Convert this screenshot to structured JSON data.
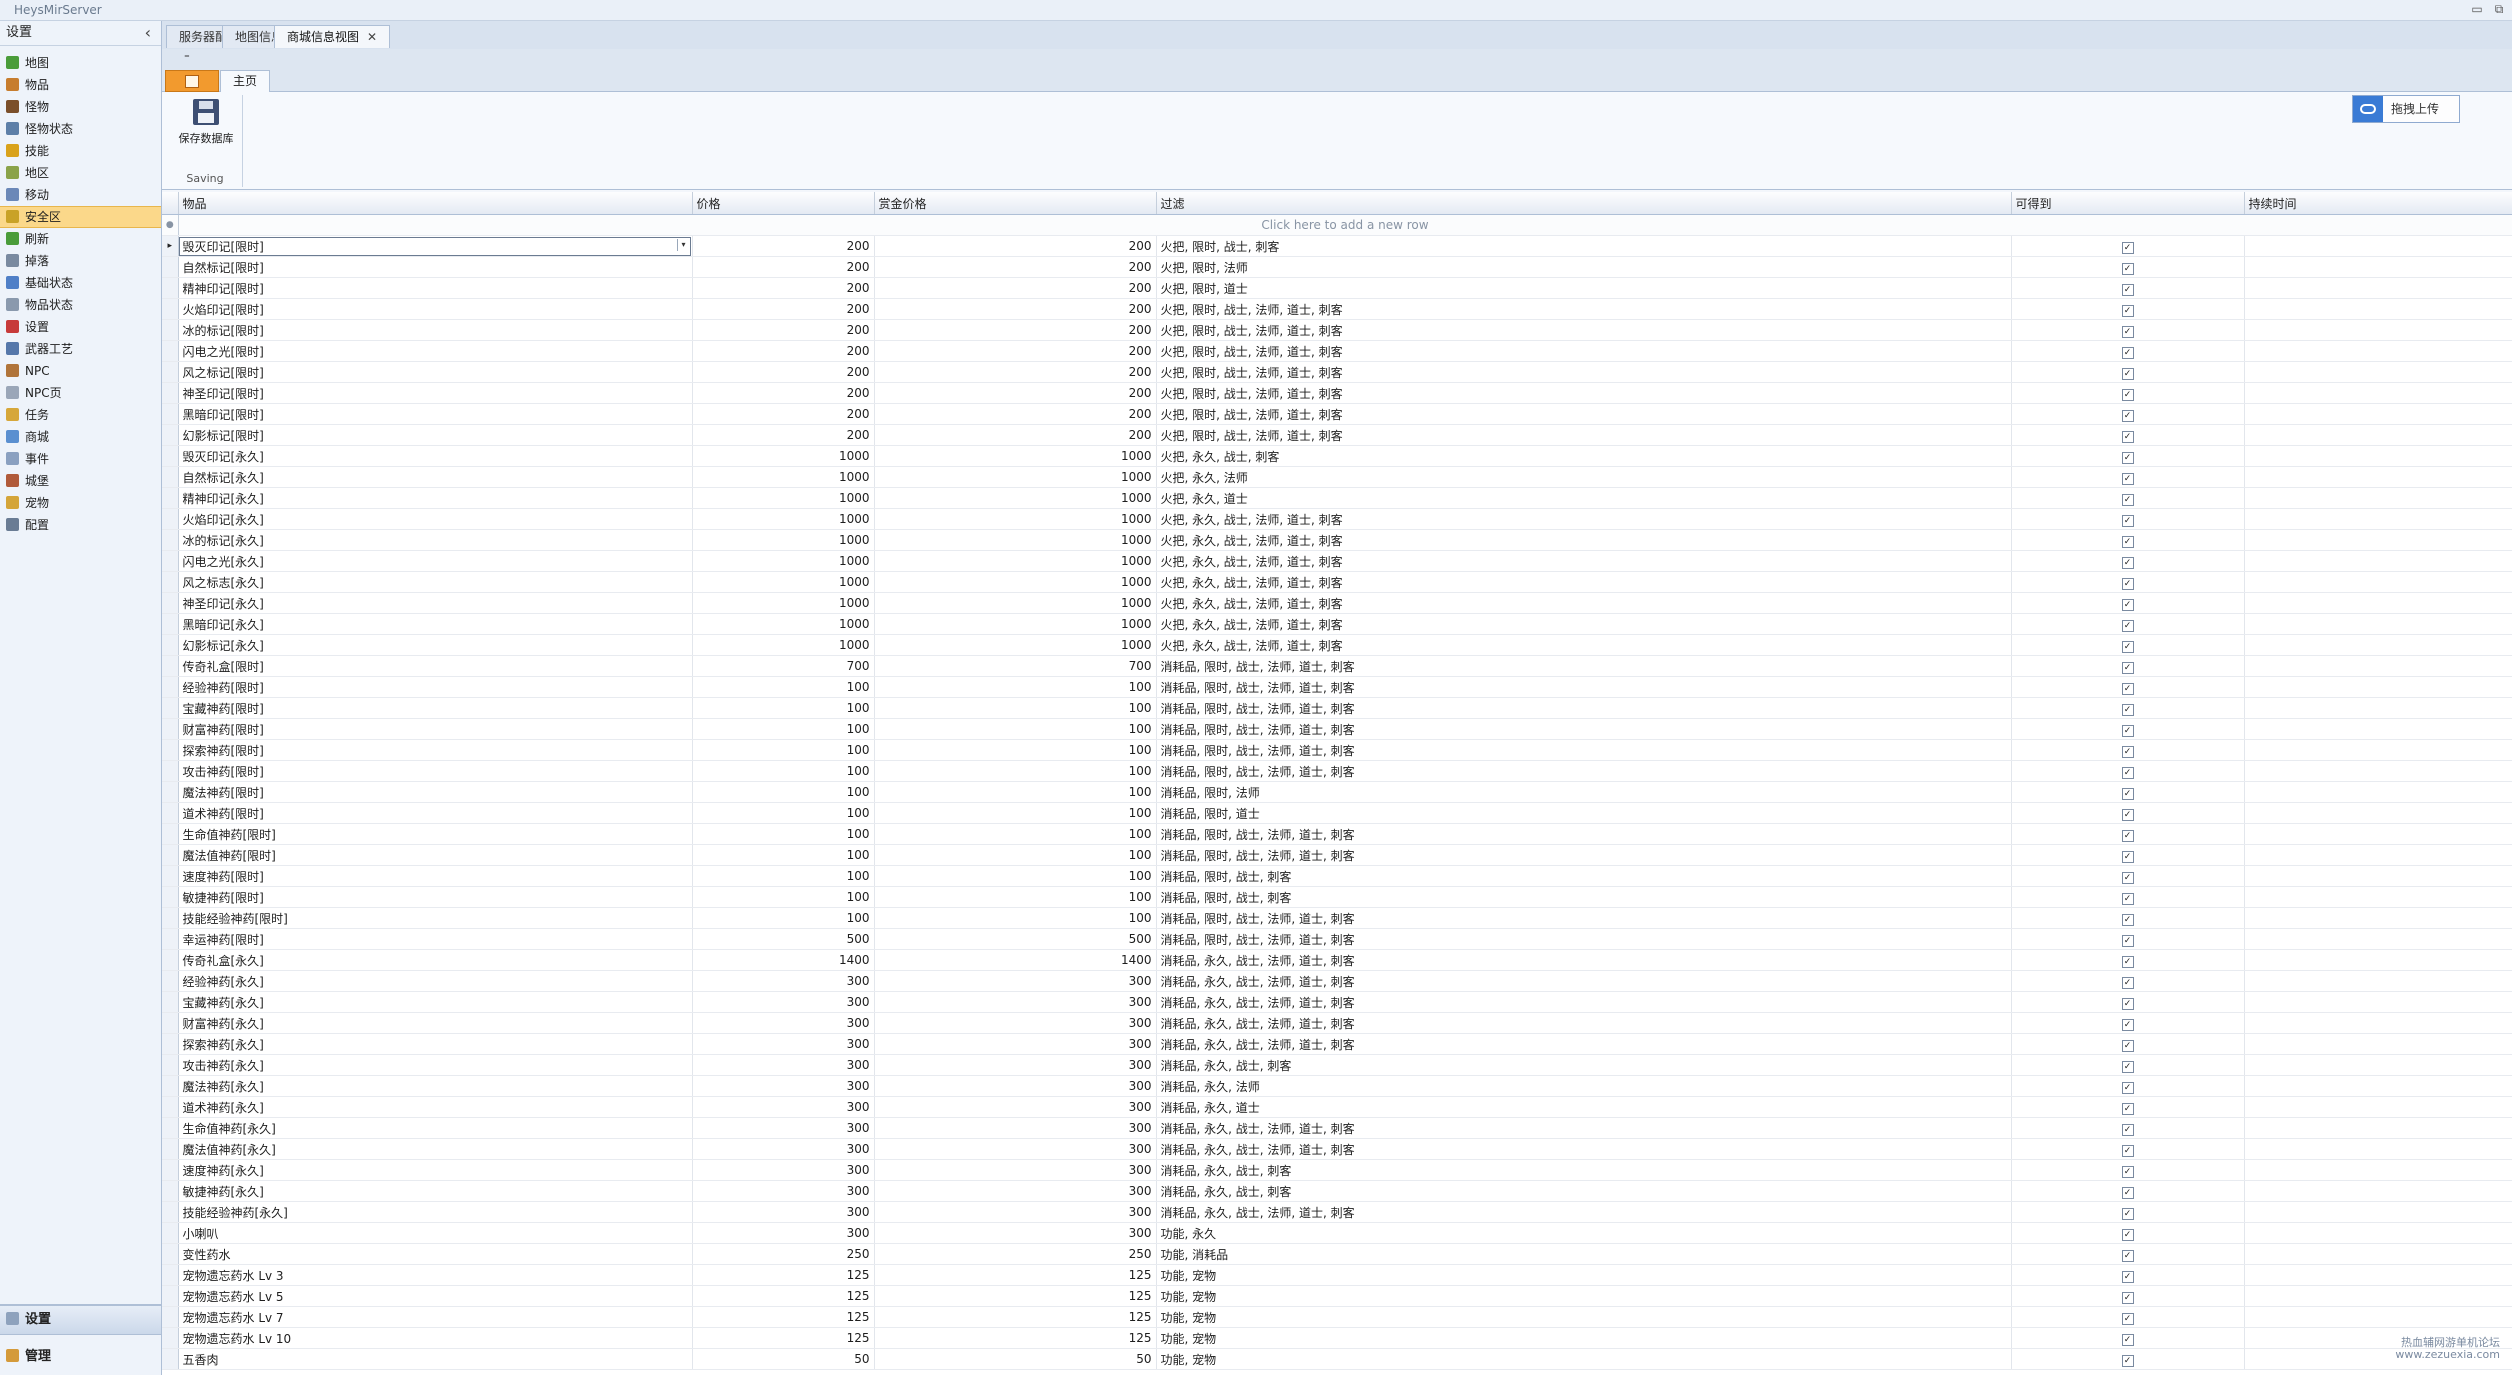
{
  "app": {
    "title": "HeysMirServer"
  },
  "sidebar": {
    "header": "设置",
    "items": [
      {
        "label": "地图",
        "icon": "map-icon",
        "color": "#4a9c3a"
      },
      {
        "label": "物品",
        "icon": "item-icon",
        "color": "#c77d2e"
      },
      {
        "label": "怪物",
        "icon": "monster-icon",
        "color": "#7b4f2a"
      },
      {
        "label": "怪物状态",
        "icon": "monster-status-icon",
        "color": "#5d7fa8"
      },
      {
        "label": "技能",
        "icon": "skill-icon",
        "color": "#d9a21b"
      },
      {
        "label": "地区",
        "icon": "region-icon",
        "color": "#8aa34a"
      },
      {
        "label": "移动",
        "icon": "move-icon",
        "color": "#6b88b8"
      },
      {
        "label": "安全区",
        "icon": "safezone-icon",
        "color": "#c9a227"
      },
      {
        "label": "刷新",
        "icon": "refresh-icon",
        "color": "#4a9c3a"
      },
      {
        "label": "掉落",
        "icon": "drop-icon",
        "color": "#7a8aa0"
      },
      {
        "label": "基础状态",
        "icon": "base-stats-icon",
        "color": "#4f7fc7"
      },
      {
        "label": "物品状态",
        "icon": "item-stats-icon",
        "color": "#8a99ad"
      },
      {
        "label": "设置",
        "icon": "settings-icon",
        "color": "#c73a3a"
      },
      {
        "label": "武器工艺",
        "icon": "weapon-craft-icon",
        "color": "#5577aa"
      },
      {
        "label": "NPC",
        "icon": "npc-icon",
        "color": "#b0743a"
      },
      {
        "label": "NPC页",
        "icon": "npc-page-icon",
        "color": "#9aa6b8"
      },
      {
        "label": "任务",
        "icon": "quest-icon",
        "color": "#d6a73a"
      },
      {
        "label": "商城",
        "icon": "shop-icon",
        "color": "#5a8fd0"
      },
      {
        "label": "事件",
        "icon": "event-icon",
        "color": "#8aa0c0"
      },
      {
        "label": "城堡",
        "icon": "castle-icon",
        "color": "#b05a3a"
      },
      {
        "label": "宠物",
        "icon": "pet-icon",
        "color": "#d4a53a"
      },
      {
        "label": "配置",
        "icon": "config-icon",
        "color": "#6a7c94"
      }
    ],
    "active_index": 7,
    "groups": [
      {
        "label": "设置",
        "icon": "settings-group-icon"
      },
      {
        "label": "管理",
        "icon": "manage-group-icon"
      }
    ]
  },
  "doctabs": [
    {
      "label": "服务器配置"
    },
    {
      "label": "地图信息"
    },
    {
      "label": "商城信息视图",
      "close": "✕"
    }
  ],
  "ribbon": {
    "qat": "⁼",
    "tab": "主页",
    "save_label": "保存数据库",
    "group_caption": "Saving",
    "upload_label": "拖拽上传"
  },
  "grid": {
    "columns": [
      "物品",
      "价格",
      "赏金价格",
      "过滤",
      "可得到",
      "持续时间"
    ],
    "new_row_hint": "Click here to add a new row",
    "rows": [
      [
        "毁灭印记[限时]",
        "200",
        "200",
        "火把, 限时, 战士, 刺客"
      ],
      [
        "自然标记[限时]",
        "200",
        "200",
        "火把, 限时, 法师"
      ],
      [
        "精神印记[限时]",
        "200",
        "200",
        "火把, 限时, 道士"
      ],
      [
        "火焰印记[限时]",
        "200",
        "200",
        "火把, 限时, 战士, 法师, 道士, 刺客"
      ],
      [
        "冰的标记[限时]",
        "200",
        "200",
        "火把, 限时, 战士, 法师, 道士, 刺客"
      ],
      [
        "闪电之光[限时]",
        "200",
        "200",
        "火把, 限时, 战士, 法师, 道士, 刺客"
      ],
      [
        "风之标记[限时]",
        "200",
        "200",
        "火把, 限时, 战士, 法师, 道士, 刺客"
      ],
      [
        "神圣印记[限时]",
        "200",
        "200",
        "火把, 限时, 战士, 法师, 道士, 刺客"
      ],
      [
        "黑暗印记[限时]",
        "200",
        "200",
        "火把, 限时, 战士, 法师, 道士, 刺客"
      ],
      [
        "幻影标记[限时]",
        "200",
        "200",
        "火把, 限时, 战士, 法师, 道士, 刺客"
      ],
      [
        "毁灭印记[永久]",
        "1000",
        "1000",
        "火把, 永久, 战士, 刺客"
      ],
      [
        "自然标记[永久]",
        "1000",
        "1000",
        "火把, 永久, 法师"
      ],
      [
        "精神印记[永久]",
        "1000",
        "1000",
        "火把, 永久, 道士"
      ],
      [
        "火焰印记[永久]",
        "1000",
        "1000",
        "火把, 永久, 战士, 法师, 道士, 刺客"
      ],
      [
        "冰的标记[永久]",
        "1000",
        "1000",
        "火把, 永久, 战士, 法师, 道士, 刺客"
      ],
      [
        "闪电之光[永久]",
        "1000",
        "1000",
        "火把, 永久, 战士, 法师, 道士, 刺客"
      ],
      [
        "风之标志[永久]",
        "1000",
        "1000",
        "火把, 永久, 战士, 法师, 道士, 刺客"
      ],
      [
        "神圣印记[永久]",
        "1000",
        "1000",
        "火把, 永久, 战士, 法师, 道士, 刺客"
      ],
      [
        "黑暗印记[永久]",
        "1000",
        "1000",
        "火把, 永久, 战士, 法师, 道士, 刺客"
      ],
      [
        "幻影标记[永久]",
        "1000",
        "1000",
        "火把, 永久, 战士, 法师, 道士, 刺客"
      ],
      [
        "传奇礼盒[限时]",
        "700",
        "700",
        "消耗品, 限时, 战士, 法师, 道士, 刺客"
      ],
      [
        "经验神药[限时]",
        "100",
        "100",
        "消耗品, 限时, 战士, 法师, 道士, 刺客"
      ],
      [
        "宝藏神药[限时]",
        "100",
        "100",
        "消耗品, 限时, 战士, 法师, 道士, 刺客"
      ],
      [
        "财富神药[限时]",
        "100",
        "100",
        "消耗品, 限时, 战士, 法师, 道士, 刺客"
      ],
      [
        "探索神药[限时]",
        "100",
        "100",
        "消耗品, 限时, 战士, 法师, 道士, 刺客"
      ],
      [
        "攻击神药[限时]",
        "100",
        "100",
        "消耗品, 限时, 战士, 法师, 道士, 刺客"
      ],
      [
        "魔法神药[限时]",
        "100",
        "100",
        "消耗品, 限时, 法师"
      ],
      [
        "道术神药[限时]",
        "100",
        "100",
        "消耗品, 限时, 道士"
      ],
      [
        "生命值神药[限时]",
        "100",
        "100",
        "消耗品, 限时, 战士, 法师, 道士, 刺客"
      ],
      [
        "魔法值神药[限时]",
        "100",
        "100",
        "消耗品, 限时, 战士, 法师, 道士, 刺客"
      ],
      [
        "速度神药[限时]",
        "100",
        "100",
        "消耗品, 限时, 战士, 刺客"
      ],
      [
        "敏捷神药[限时]",
        "100",
        "100",
        "消耗品, 限时, 战士, 刺客"
      ],
      [
        "技能经验神药[限时]",
        "100",
        "100",
        "消耗品, 限时, 战士, 法师, 道士, 刺客"
      ],
      [
        "幸运神药[限时]",
        "500",
        "500",
        "消耗品, 限时, 战士, 法师, 道士, 刺客"
      ],
      [
        "传奇礼盒[永久]",
        "1400",
        "1400",
        "消耗品, 永久, 战士, 法师, 道士, 刺客"
      ],
      [
        "经验神药[永久]",
        "300",
        "300",
        "消耗品, 永久, 战士, 法师, 道士, 刺客"
      ],
      [
        "宝藏神药[永久]",
        "300",
        "300",
        "消耗品, 永久, 战士, 法师, 道士, 刺客"
      ],
      [
        "财富神药[永久]",
        "300",
        "300",
        "消耗品, 永久, 战士, 法师, 道士, 刺客"
      ],
      [
        "探索神药[永久]",
        "300",
        "300",
        "消耗品, 永久, 战士, 法师, 道士, 刺客"
      ],
      [
        "攻击神药[永久]",
        "300",
        "300",
        "消耗品, 永久, 战士, 刺客"
      ],
      [
        "魔法神药[永久]",
        "300",
        "300",
        "消耗品, 永久, 法师"
      ],
      [
        "道术神药[永久]",
        "300",
        "300",
        "消耗品, 永久, 道士"
      ],
      [
        "生命值神药[永久]",
        "300",
        "300",
        "消耗品, 永久, 战士, 法师, 道士, 刺客"
      ],
      [
        "魔法值神药[永久]",
        "300",
        "300",
        "消耗品, 永久, 战士, 法师, 道士, 刺客"
      ],
      [
        "速度神药[永久]",
        "300",
        "300",
        "消耗品, 永久, 战士, 刺客"
      ],
      [
        "敏捷神药[永久]",
        "300",
        "300",
        "消耗品, 永久, 战士, 刺客"
      ],
      [
        "技能经验神药[永久]",
        "300",
        "300",
        "消耗品, 永久, 战士, 法师, 道士, 刺客"
      ],
      [
        "小喇叭",
        "300",
        "300",
        "功能, 永久"
      ],
      [
        "变性药水",
        "250",
        "250",
        "功能, 消耗品"
      ],
      [
        "宠物遗忘药水 Lv 3",
        "125",
        "125",
        "功能, 宠物"
      ],
      [
        "宠物遗忘药水 Lv 5",
        "125",
        "125",
        "功能, 宠物"
      ],
      [
        "宠物遗忘药水 Lv 7",
        "125",
        "125",
        "功能, 宠物"
      ],
      [
        "宠物遗忘药水 Lv 10",
        "125",
        "125",
        "功能, 宠物"
      ],
      [
        "五香肉",
        "50",
        "50",
        "功能, 宠物"
      ]
    ],
    "check_mark": "✓",
    "current_row_marker": "▸",
    "new_row_marker": "●",
    "dropdown_arrow": "▾"
  },
  "watermark": {
    "line1": "热血辅网游单机论坛",
    "line2": "www.zezuexia.com"
  },
  "window_buttons": {
    "minimize": "▭",
    "restore": "⧉"
  }
}
